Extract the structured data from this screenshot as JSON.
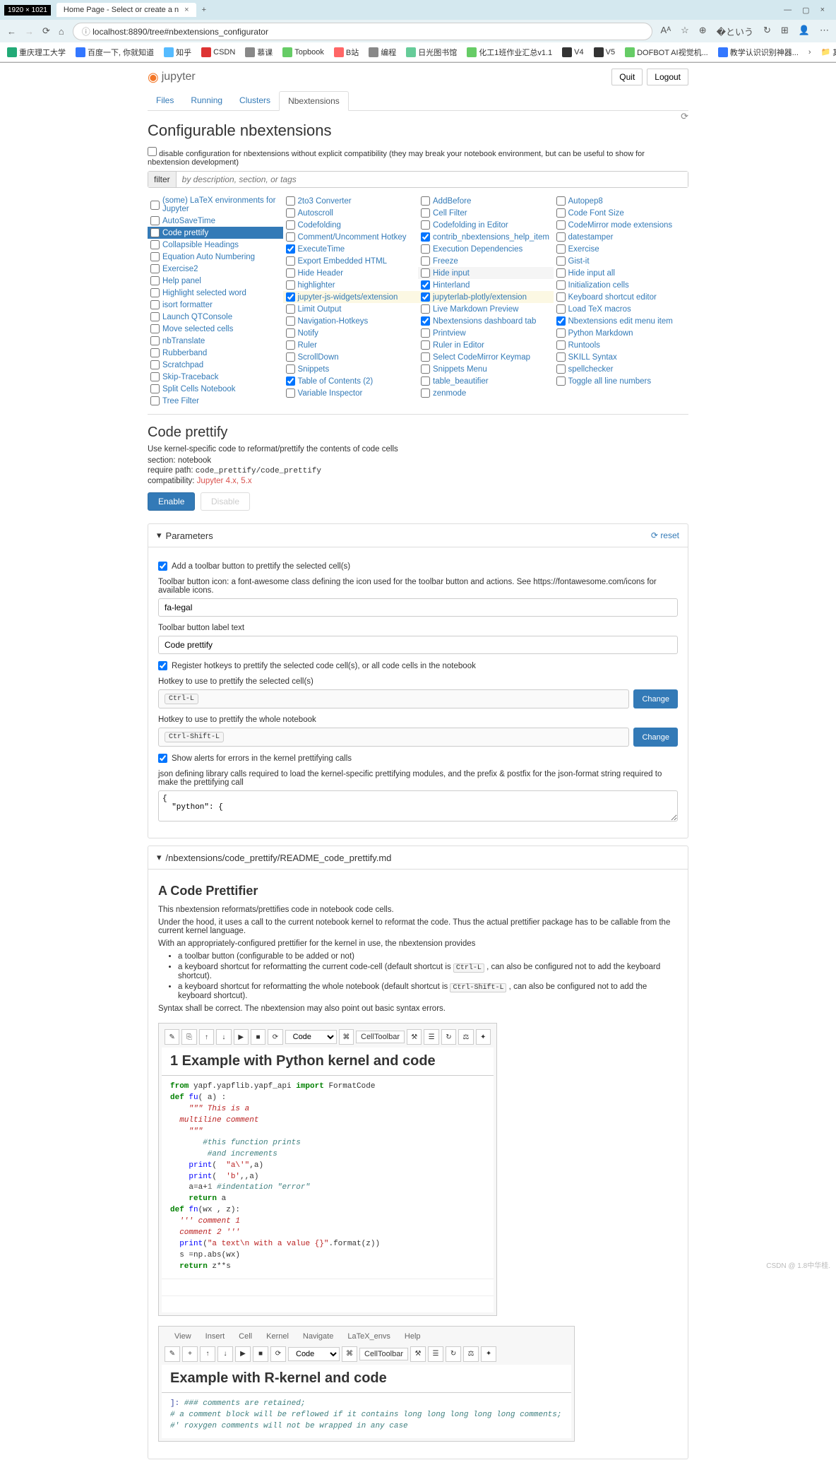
{
  "browser": {
    "size_badge": "1920 × 1021",
    "tab_title": "Home Page - Select or create a n",
    "url": "localhost:8890/tree#nbextensions_configurator",
    "bookmarks": [
      "重庆理工大学",
      "百度一下, 你就知道",
      "知乎",
      "CSDN",
      "慕课",
      "Topbook",
      "B站",
      "编程",
      "日光图书馆",
      "化工1班作业汇总v1.1",
      "V4",
      "V5",
      "DOFBOT AI视觉机...",
      "教学认识识别神器..."
    ],
    "other_bookmarks": "其他收藏夹"
  },
  "header": {
    "quit": "Quit",
    "logout": "Logout",
    "logo": "jupyter"
  },
  "tabs": {
    "files": "Files",
    "running": "Running",
    "clusters": "Clusters",
    "nbext": "Nbextensions"
  },
  "title": "Configurable nbextensions",
  "compat_disable": "disable configuration for nbextensions without explicit compatibility (they may break your notebook environment, but can be useful to show for nbextension development)",
  "filter": {
    "label": "filter",
    "placeholder": "by description, section, or tags"
  },
  "ext_cols": [
    [
      {
        "label": "(some) LaTeX environments for Jupyter",
        "ck": false
      },
      {
        "label": "AutoSaveTime",
        "ck": false
      },
      {
        "label": "Code prettify",
        "ck": false,
        "sel": true
      },
      {
        "label": "Collapsible Headings",
        "ck": false
      },
      {
        "label": "Equation Auto Numbering",
        "ck": false
      },
      {
        "label": "Exercise2",
        "ck": false
      },
      {
        "label": "Help panel",
        "ck": false
      },
      {
        "label": "Highlight selected word",
        "ck": false
      },
      {
        "label": "isort formatter",
        "ck": false
      },
      {
        "label": "Launch QTConsole",
        "ck": false
      },
      {
        "label": "Move selected cells",
        "ck": false
      },
      {
        "label": "nbTranslate",
        "ck": false
      },
      {
        "label": "Rubberband",
        "ck": false
      },
      {
        "label": "Scratchpad",
        "ck": false
      },
      {
        "label": "Skip-Traceback",
        "ck": false
      },
      {
        "label": "Split Cells Notebook",
        "ck": false
      },
      {
        "label": "Tree Filter",
        "ck": false
      }
    ],
    [
      {
        "label": "2to3 Converter",
        "ck": false
      },
      {
        "label": "Autoscroll",
        "ck": false
      },
      {
        "label": "Codefolding",
        "ck": false
      },
      {
        "label": "Comment/Uncomment Hotkey",
        "ck": false
      },
      {
        "label": "ExecuteTime",
        "ck": true
      },
      {
        "label": "Export Embedded HTML",
        "ck": false
      },
      {
        "label": "Hide Header",
        "ck": false
      },
      {
        "label": "highlighter",
        "ck": false
      },
      {
        "label": "jupyter-js-widgets/extension",
        "ck": true,
        "yel": true
      },
      {
        "label": "Limit Output",
        "ck": false
      },
      {
        "label": "Navigation-Hotkeys",
        "ck": false
      },
      {
        "label": "Notify",
        "ck": false
      },
      {
        "label": "Ruler",
        "ck": false
      },
      {
        "label": "ScrollDown",
        "ck": false
      },
      {
        "label": "Snippets",
        "ck": false
      },
      {
        "label": "Table of Contents (2)",
        "ck": true
      },
      {
        "label": "Variable Inspector",
        "ck": false
      }
    ],
    [
      {
        "label": "AddBefore",
        "ck": false
      },
      {
        "label": "Cell Filter",
        "ck": false
      },
      {
        "label": "Codefolding in Editor",
        "ck": false
      },
      {
        "label": "contrib_nbextensions_help_item",
        "ck": true
      },
      {
        "label": "Execution Dependencies",
        "ck": false
      },
      {
        "label": "Freeze",
        "ck": false
      },
      {
        "label": "Hide input",
        "ck": false,
        "hov": true
      },
      {
        "label": "Hinterland",
        "ck": true
      },
      {
        "label": "jupyterlab-plotly/extension",
        "ck": true,
        "yel": true
      },
      {
        "label": "Live Markdown Preview",
        "ck": false
      },
      {
        "label": "Nbextensions dashboard tab",
        "ck": true
      },
      {
        "label": "Printview",
        "ck": false
      },
      {
        "label": "Ruler in Editor",
        "ck": false
      },
      {
        "label": "Select CodeMirror Keymap",
        "ck": false
      },
      {
        "label": "Snippets Menu",
        "ck": false
      },
      {
        "label": "table_beautifier",
        "ck": false
      },
      {
        "label": "zenmode",
        "ck": false
      }
    ],
    [
      {
        "label": "Autopep8",
        "ck": false
      },
      {
        "label": "Code Font Size",
        "ck": false
      },
      {
        "label": "CodeMirror mode extensions",
        "ck": false
      },
      {
        "label": "datestamper",
        "ck": false
      },
      {
        "label": "Exercise",
        "ck": false
      },
      {
        "label": "Gist-it",
        "ck": false
      },
      {
        "label": "Hide input all",
        "ck": false
      },
      {
        "label": "Initialization cells",
        "ck": false
      },
      {
        "label": "Keyboard shortcut editor",
        "ck": false
      },
      {
        "label": "Load TeX macros",
        "ck": false
      },
      {
        "label": "Nbextensions edit menu item",
        "ck": true
      },
      {
        "label": "Python Markdown",
        "ck": false
      },
      {
        "label": "Runtools",
        "ck": false
      },
      {
        "label": "SKILL Syntax",
        "ck": false
      },
      {
        "label": "spellchecker",
        "ck": false
      },
      {
        "label": "Toggle all line numbers",
        "ck": false
      }
    ]
  ],
  "detail": {
    "name": "Code prettify",
    "desc": "Use kernel-specific code to reformat/prettify the contents of code cells",
    "section": "section: notebook",
    "require": "require path: ",
    "require_path": "code_prettify/code_prettify",
    "compat": "compatibility: ",
    "compat_val": "Jupyter 4.x, 5.x",
    "enable": "Enable",
    "disable": "Disable"
  },
  "params": {
    "title": "Parameters",
    "reset": "reset",
    "p1": "Add a toolbar button to prettify the selected cell(s)",
    "p2label": "Toolbar button icon: a font-awesome class defining the icon used for the toolbar button and actions. See https://fontawesome.com/icons for available icons.",
    "p2val": "fa-legal",
    "p3label": "Toolbar button label text",
    "p3val": "Code prettify",
    "p4": "Register hotkeys to prettify the selected code cell(s), or all code cells in the notebook",
    "p5label": "Hotkey to use to prettify the selected cell(s)",
    "p5val": "Ctrl-L",
    "change": "Change",
    "p6label": "Hotkey to use to prettify the whole notebook",
    "p6val": "Ctrl-Shift-L",
    "p7": "Show alerts for errors in the kernel prettifying calls",
    "p8label": "json defining library calls required to load the kernel-specific prettifying modules, and the prefix & postfix for the json-format string required to make the prettifying call",
    "p8val": "{\n  \"python\": {"
  },
  "readme": {
    "path": "/nbextensions/code_prettify/README_code_prettify.md",
    "h": "A Code Prettifier",
    "p1": "This nbextension reformats/prettifies code in notebook code cells.",
    "p2": "Under the hood, it uses a call to the current notebook kernel to reformat the code. Thus the actual prettifier package has to be callable from the current kernel language.",
    "p3": "With an appropriately-configured prettifier for the kernel in use, the nbextension provides",
    "li1": "a toolbar button (configurable to be added or not)",
    "li2a": "a keyboard shortcut for reformatting the current code-cell (default shortcut is ",
    "li2k": "Ctrl-L",
    "li2b": " , can also be configured not to add the keyboard shortcut).",
    "li3a": "a keyboard shortcut for reformatting the whole notebook (default shortcut is ",
    "li3k": "Ctrl-Shift-L",
    "li3b": " , can also be configured not to add the keyboard shortcut).",
    "p4": "Syntax shall be correct. The nbextension may also point out basic syntax errors."
  },
  "nb1": {
    "celltoolbar": "CellToolbar",
    "code_sel": "Code",
    "h1": "1  Example with Python kernel and code"
  },
  "nb2": {
    "menus": [
      "View",
      "Insert",
      "Cell",
      "Kernel",
      "Navigate",
      "LaTeX_envs",
      "Help"
    ],
    "celltoolbar": "CellToolbar",
    "code_sel": "Code",
    "h1": "Example with R-kernel and code"
  },
  "watermark": "CSDN @ 1.8中华桂."
}
